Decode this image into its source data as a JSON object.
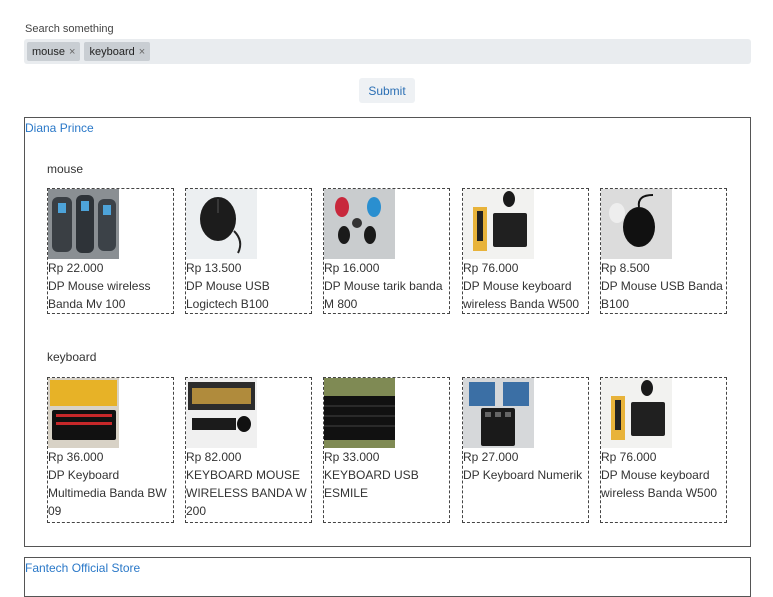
{
  "search": {
    "label": "Search something",
    "chips": [
      "mouse",
      "keyboard"
    ],
    "remove_glyph": "×"
  },
  "submit_label": "Submit",
  "stores": [
    {
      "name": "Diana Prince",
      "categories": [
        {
          "label": "mouse",
          "products": [
            {
              "price": "Rp 22.000",
              "title": "DP Mouse wireless Banda Mv 100"
            },
            {
              "price": "Rp 13.500",
              "title": "DP Mouse USB Logictech B100"
            },
            {
              "price": "Rp 16.000",
              "title": "DP Mouse tarik banda M 800"
            },
            {
              "price": "Rp 76.000",
              "title": "DP Mouse keyboard wireless Banda W500"
            },
            {
              "price": "Rp 8.500",
              "title": "DP Mouse USB Banda B100"
            }
          ]
        },
        {
          "label": "keyboard",
          "products": [
            {
              "price": "Rp 36.000",
              "title": "DP Keyboard Multimedia Banda BW 09"
            },
            {
              "price": "Rp 82.000",
              "title": "KEYBOARD MOUSE WIRELESS BANDA W 200"
            },
            {
              "price": "Rp 33.000",
              "title": "KEYBOARD USB ESMILE"
            },
            {
              "price": "Rp 27.000",
              "title": "DP Keyboard Numerik"
            },
            {
              "price": "Rp 76.000",
              "title": "DP Mouse keyboard wireless Banda W500"
            }
          ]
        }
      ]
    },
    {
      "name": "Fantech Official Store"
    }
  ],
  "colors": {
    "link": "#2a78c8",
    "search_bg": "#e9ecef",
    "chip_bg": "#c9ced3"
  }
}
